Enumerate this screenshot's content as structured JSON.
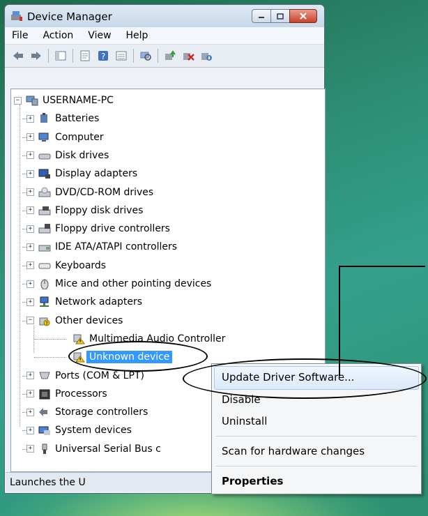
{
  "window": {
    "title": "Device Manager",
    "menus": [
      "File",
      "Action",
      "View",
      "Help"
    ],
    "toolbar_icons": [
      "back-icon",
      "forward-icon",
      "show-hide-tree-icon",
      "properties-icon",
      "help-icon",
      "view-icon",
      "scan-hardware-icon",
      "update-driver-icon",
      "uninstall-icon",
      "disable-icon"
    ]
  },
  "tree": {
    "root": "USERNAME-PC",
    "categories": [
      {
        "label": "Batteries",
        "icon": "battery-icon"
      },
      {
        "label": "Computer",
        "icon": "computer-icon"
      },
      {
        "label": "Disk drives",
        "icon": "disk-drive-icon"
      },
      {
        "label": "Display adapters",
        "icon": "display-adapter-icon"
      },
      {
        "label": "DVD/CD-ROM drives",
        "icon": "dvd-drive-icon"
      },
      {
        "label": "Floppy disk drives",
        "icon": "floppy-drive-icon"
      },
      {
        "label": "Floppy drive controllers",
        "icon": "floppy-controller-icon"
      },
      {
        "label": "IDE ATA/ATAPI controllers",
        "icon": "ide-controller-icon"
      },
      {
        "label": "Keyboards",
        "icon": "keyboard-icon"
      },
      {
        "label": "Mice and other pointing devices",
        "icon": "mouse-icon"
      },
      {
        "label": "Network adapters",
        "icon": "network-adapter-icon"
      },
      {
        "label": "Other devices",
        "icon": "other-devices-icon"
      }
    ],
    "other_devices_children": [
      {
        "label": "Multimedia Audio Controller",
        "icon": "warning-device-icon"
      },
      {
        "label": "Unknown device",
        "icon": "warning-device-icon"
      }
    ],
    "after_categories": [
      {
        "label": "Ports (COM & LPT)",
        "icon": "port-icon"
      },
      {
        "label": "Processors",
        "icon": "processor-icon"
      },
      {
        "label": "Storage controllers",
        "icon": "storage-controller-icon"
      },
      {
        "label": "System devices",
        "icon": "system-devices-icon"
      },
      {
        "label": "Universal Serial Bus c",
        "icon": "usb-icon"
      }
    ]
  },
  "status": "Launches the U",
  "context_menu": {
    "items": [
      "Update Driver Software...",
      "Disable",
      "Uninstall",
      "Scan for hardware changes",
      "Properties"
    ]
  },
  "colors": {
    "selection": "#3399ff",
    "desktop": "#2d8d73"
  }
}
